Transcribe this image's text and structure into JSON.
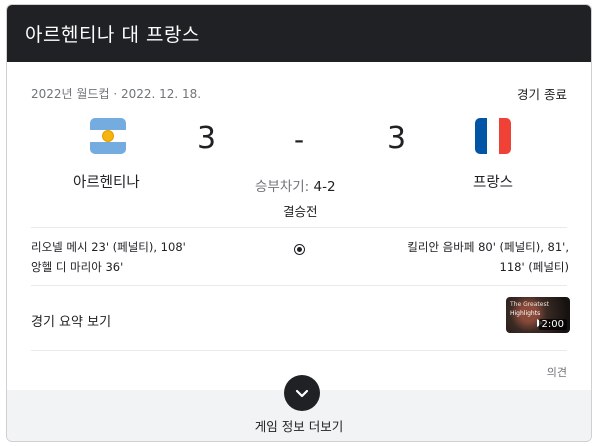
{
  "header": {
    "title": "아르헨티나 대 프랑스"
  },
  "match": {
    "meta": "2022년 월드컵 · 2022. 12. 18.",
    "status": "경기 종료",
    "home": {
      "name": "아르헨티나",
      "score": "3",
      "flag_icon": "argentina-flag"
    },
    "away": {
      "name": "프랑스",
      "score": "3",
      "flag_icon": "france-flag"
    },
    "separator": "-",
    "penalty_label": "승부차기:",
    "penalty_score": "4-2",
    "stage": "결승전"
  },
  "scorers": {
    "home_line1": "리오넬 메시 23' (페널티), 108'",
    "home_line2": "앙헬 디 마리아 36'",
    "away_line1": "킬리안 음바페 80' (페널티), 81',",
    "away_line2": "118' (페널티)",
    "icon": "soccer-ball-icon"
  },
  "summary": {
    "label": "경기 요약 보기",
    "thumb_title": "The Greatest",
    "thumb_caption": "Highlights",
    "duration": "2:00"
  },
  "feedback": "의견",
  "more": {
    "label": "게임 정보 더보기",
    "icon": "chevron-down-icon"
  },
  "colors": {
    "header_bg": "#202124",
    "footer_bg": "#f1f3f4",
    "muted": "#70757a"
  }
}
